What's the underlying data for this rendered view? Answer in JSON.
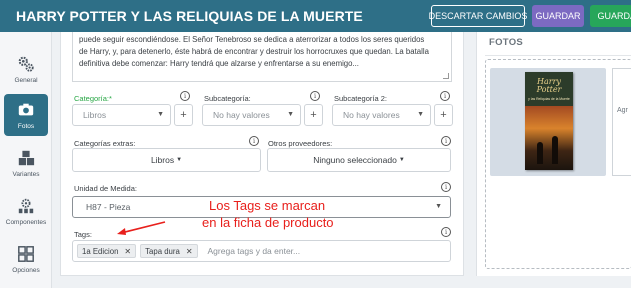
{
  "header": {
    "title": "HARRY POTTER Y LAS RELIQUIAS DE LA MUERTE",
    "discard_label": "DESCARTAR CAMBIOS",
    "save_label": "GUARDAR",
    "save_secondary_label": "GUARDAR"
  },
  "sidebar": {
    "items": [
      {
        "label": "General",
        "icon": "gears-icon"
      },
      {
        "label": "Fotos",
        "icon": "camera-icon"
      },
      {
        "label": "Variantes",
        "icon": "boxes-icon"
      },
      {
        "label": "Componentes",
        "icon": "components-icon"
      },
      {
        "label": "Opciones",
        "icon": "grid-icon"
      }
    ],
    "active": "Fotos"
  },
  "description": {
    "lines": [
      "puede seguir escondiéndose. El Señor Tenebroso se dedica a aterrorizar a todos los seres queridos",
      "de Harry, y, para detenerlo, éste habrá de encontrar y destruir los horrocruxes que quedan. La batalla",
      "definitiva debe comenzar: Harry tendrá que alzarse y enfrentarse a su enemigo..."
    ]
  },
  "fields": {
    "categoria": {
      "label": "Categoría:*",
      "value": "Libros"
    },
    "subcategoria": {
      "label": "Subcategoría:",
      "value": "No hay valores"
    },
    "subcategoria2": {
      "label": "Subcategoría 2:",
      "value": "No hay valores"
    },
    "categorias_extras": {
      "label": "Categorías extras:",
      "value": "Libros"
    },
    "otros_proveedores": {
      "label": "Otros proveedores:",
      "value": "Ninguno seleccionado"
    },
    "unidad_medida": {
      "label": "Unidad de Medida:",
      "value": "H87 - Pieza"
    },
    "tags": {
      "label": "Tags:",
      "chips": [
        "1a Edicion",
        "Tapa dura"
      ],
      "placeholder": "Agrega tags y da enter..."
    }
  },
  "annotation": {
    "line1": "Los Tags se marcan",
    "line2": "en la ficha de producto",
    "color": "#e8201c"
  },
  "photos": {
    "title": "FOTOS",
    "book_brand": "Harry Potter",
    "book_subtitle": "y las Reliquias de la Muerte",
    "second_label": "Agr"
  },
  "colors": {
    "header_bg": "#2e6f87",
    "save_bg": "#7c6ac2",
    "save_secondary_bg": "#27a65a",
    "required_label": "#28a745"
  }
}
